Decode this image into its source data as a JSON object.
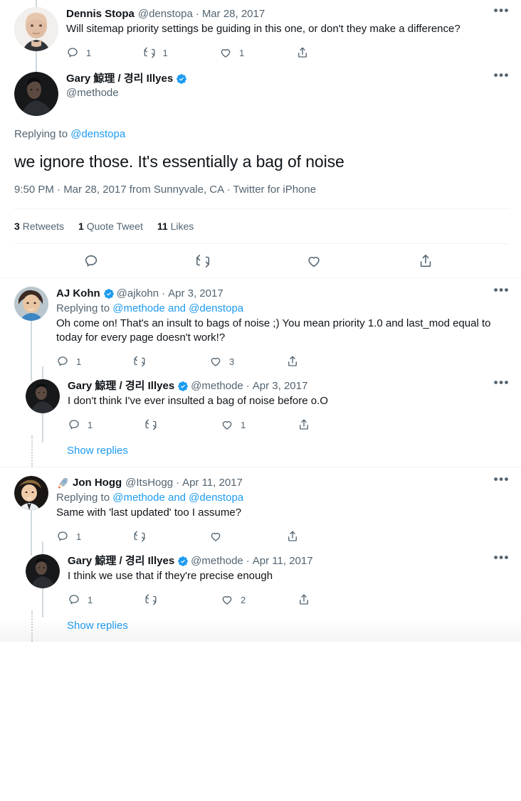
{
  "colors": {
    "link": "#1d9bf0",
    "text": "#0f1419",
    "muted": "#536471",
    "separator": "#eff3f4",
    "thread_line": "#cfd9de",
    "verified_badge": "#1d9bf0"
  },
  "quoted_tweet": {
    "author_name": "Dennis Stopa",
    "author_handle": "@denstopa",
    "separator_dot": "·",
    "date": "Mar 28, 2017",
    "text": "Will sitemap priority settings be guiding in this one, or don't they make a difference?",
    "more_icon": "more-horizontal-icon",
    "actions": {
      "reply": {
        "icon": "reply-icon",
        "count": "1"
      },
      "retweet": {
        "icon": "retweet-icon",
        "count": "1"
      },
      "like": {
        "icon": "heart-icon",
        "count": "1"
      },
      "share": {
        "icon": "share-icon",
        "count": ""
      }
    }
  },
  "focal_tweet": {
    "author_name": "Gary 鯨理 / 경리 Illyes",
    "author_handle": "@methode",
    "verified": true,
    "verified_icon": "verified-badge-icon",
    "more_icon": "more-horizontal-icon",
    "replying_prefix": "Replying to ",
    "replying_mentions": "@denstopa",
    "text": "we ignore those. It's essentially a bag of noise",
    "meta": "9:50 PM · Mar 28, 2017 from Sunnyvale, CA · Twitter for iPhone",
    "stats": {
      "retweets_count": "3",
      "retweets_label": "Retweets",
      "quotes_count": "1",
      "quotes_label": "Quote Tweet",
      "likes_count": "11",
      "likes_label": "Likes"
    },
    "actions": {
      "reply": {
        "icon": "reply-icon"
      },
      "retweet": {
        "icon": "retweet-icon"
      },
      "like": {
        "icon": "heart-icon"
      },
      "share": {
        "icon": "share-icon"
      }
    }
  },
  "replies": [
    {
      "author_name": "AJ Kohn",
      "author_handle": "@ajkohn",
      "verified": true,
      "separator_dot": "·",
      "date": "Apr 3, 2017",
      "replying_prefix": "Replying to ",
      "replying_mentions": "@methode and @denstopa",
      "text": "Oh come on! That's an insult to bags of noise ;) You mean priority 1.0 and last_mod equal to today for every page doesn't work!?",
      "more_icon": "more-horizontal-icon",
      "actions": {
        "reply": {
          "icon": "reply-icon",
          "count": "1"
        },
        "retweet": {
          "icon": "retweet-icon",
          "count": ""
        },
        "like": {
          "icon": "heart-icon",
          "count": "3"
        },
        "share": {
          "icon": "share-icon",
          "count": ""
        }
      }
    },
    {
      "author_name": "Gary 鯨理 / 경리 Illyes",
      "author_handle": "@methode",
      "verified": true,
      "separator_dot": "·",
      "date": "Apr 3, 2017",
      "replying_prefix": "",
      "replying_mentions": "",
      "text": "I don't think I've ever insulted a bag of noise before o.O",
      "more_icon": "more-horizontal-icon",
      "actions": {
        "reply": {
          "icon": "reply-icon",
          "count": "1"
        },
        "retweet": {
          "icon": "retweet-icon",
          "count": ""
        },
        "like": {
          "icon": "heart-icon",
          "count": "1"
        },
        "share": {
          "icon": "share-icon",
          "count": ""
        }
      }
    },
    {
      "author_name": "Jon Hogg",
      "author_handle": "@ItsHogg",
      "verified": false,
      "emoji": "🚀",
      "emoji_icon": "rocket-emoji-icon",
      "separator_dot": "·",
      "date": "Apr 11, 2017",
      "replying_prefix": "Replying to ",
      "replying_mentions": "@methode and @denstopa",
      "text": "Same with 'last updated' too I assume?",
      "more_icon": "more-horizontal-icon",
      "actions": {
        "reply": {
          "icon": "reply-icon",
          "count": "1"
        },
        "retweet": {
          "icon": "retweet-icon",
          "count": ""
        },
        "like": {
          "icon": "heart-icon",
          "count": ""
        },
        "share": {
          "icon": "share-icon",
          "count": ""
        }
      }
    },
    {
      "author_name": "Gary 鯨理 / 경리 Illyes",
      "author_handle": "@methode",
      "verified": true,
      "separator_dot": "·",
      "date": "Apr 11, 2017",
      "replying_prefix": "",
      "replying_mentions": "",
      "text": "I think we use that if they're precise enough",
      "more_icon": "more-horizontal-icon",
      "actions": {
        "reply": {
          "icon": "reply-icon",
          "count": "1"
        },
        "retweet": {
          "icon": "retweet-icon",
          "count": ""
        },
        "like": {
          "icon": "heart-icon",
          "count": "2"
        },
        "share": {
          "icon": "share-icon",
          "count": ""
        }
      }
    }
  ],
  "show_replies_1": {
    "label": "Show replies"
  },
  "show_replies_2": {
    "label": "Show replies"
  }
}
